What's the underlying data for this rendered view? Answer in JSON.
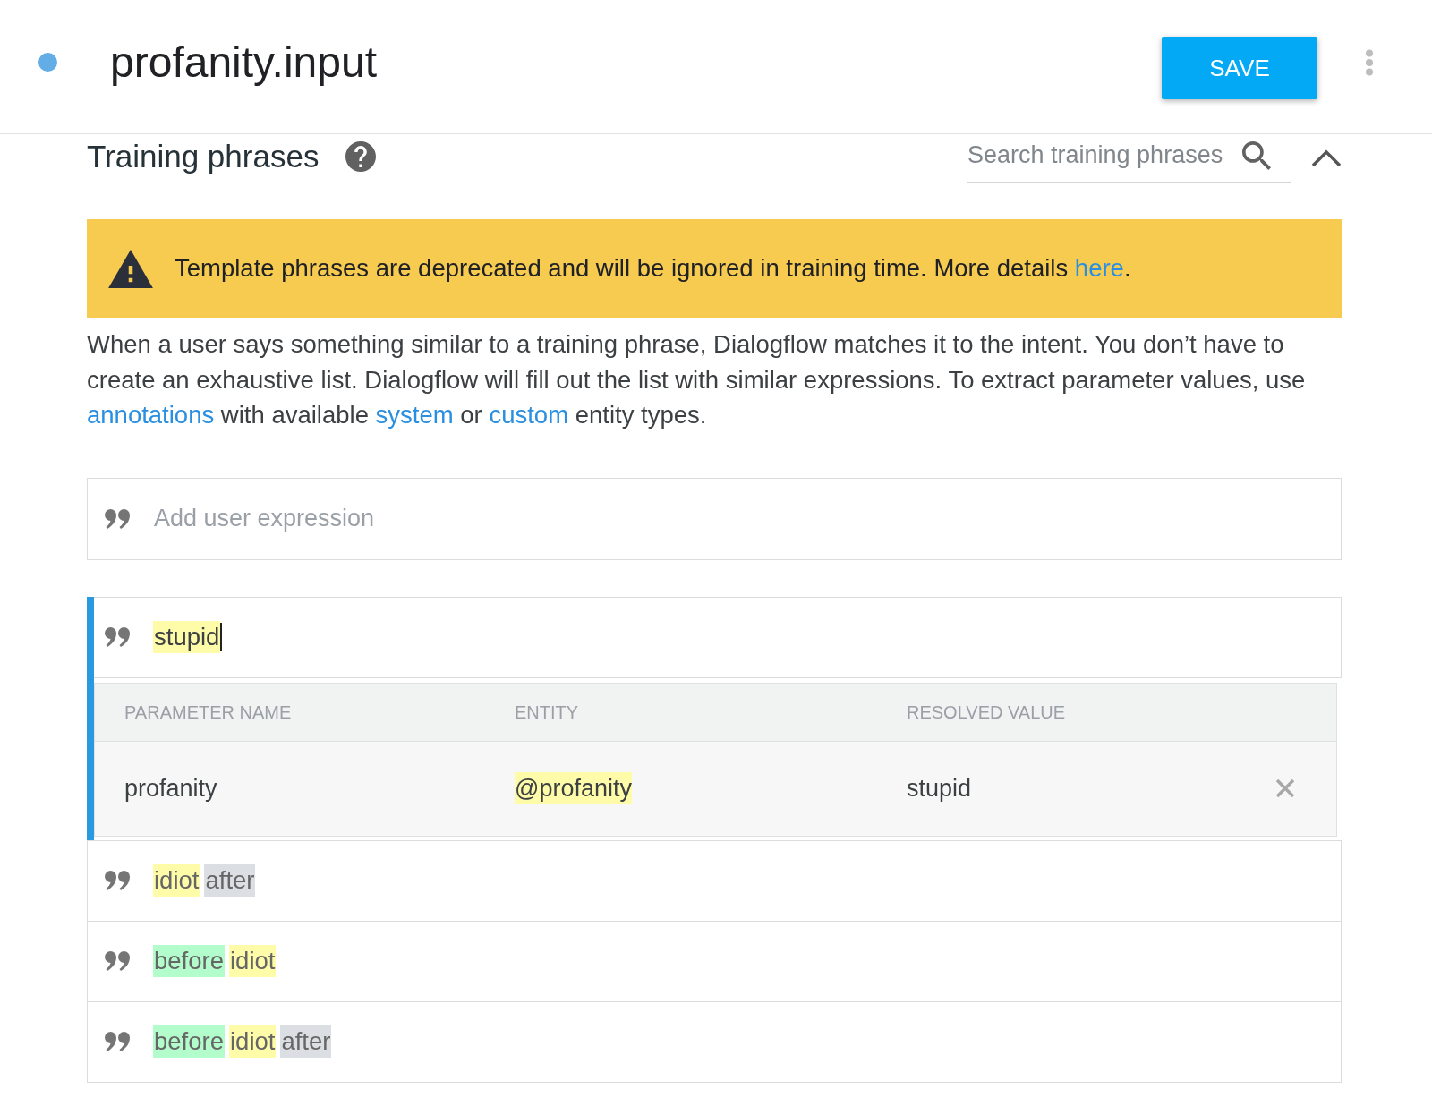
{
  "header": {
    "title": "profanity.input",
    "save_label": "SAVE"
  },
  "section": {
    "title": "Training phrases",
    "expanded": true,
    "search": {
      "placeholder": "Search training phrases"
    }
  },
  "warning": {
    "segments": [
      {
        "kind": "text",
        "text": "Template phrases are deprecated and will be ignored in training time. More details "
      },
      {
        "kind": "link",
        "text": "here"
      },
      {
        "kind": "text",
        "text": "."
      }
    ]
  },
  "description": {
    "segments": [
      {
        "kind": "text",
        "text": "When a user says something similar to a training phrase, Dialogflow matches it to the intent. You don’t have to create an exhaustive list. Dialogflow will fill out the list with similar expressions. To extract parameter values, use "
      },
      {
        "kind": "link",
        "text": "annotations"
      },
      {
        "kind": "text",
        "text": " with available "
      },
      {
        "kind": "link",
        "text": "system"
      },
      {
        "kind": "text",
        "text": " or "
      },
      {
        "kind": "link",
        "text": "custom"
      },
      {
        "kind": "text",
        "text": " entity types."
      }
    ]
  },
  "new_expression": {
    "placeholder": "Add user expression"
  },
  "phrases": [
    {
      "selected": true,
      "parts": [
        {
          "text": "stupid",
          "color": "#fefca8"
        }
      ],
      "parameters": {
        "columns": [
          "PARAMETER NAME",
          "ENTITY",
          "RESOLVED VALUE"
        ],
        "rows": [
          {
            "parameter_name": "profanity",
            "entity": {
              "text": "@profanity",
              "color": "#fefca8"
            },
            "resolved_value": "stupid"
          }
        ]
      }
    },
    {
      "selected": false,
      "parts": [
        {
          "text": "idiot",
          "color": "#fefca8"
        },
        {
          "text": "after",
          "color": "#dbdee2"
        }
      ]
    },
    {
      "selected": false,
      "parts": [
        {
          "text": "before",
          "color": "#b3fccb"
        },
        {
          "text": "idiot",
          "color": "#fefca8"
        }
      ]
    },
    {
      "selected": false,
      "parts": [
        {
          "text": "before",
          "color": "#b3fccb"
        },
        {
          "text": "idiot",
          "color": "#fefca8"
        },
        {
          "text": "after",
          "color": "#dbdee2"
        }
      ]
    }
  ]
}
